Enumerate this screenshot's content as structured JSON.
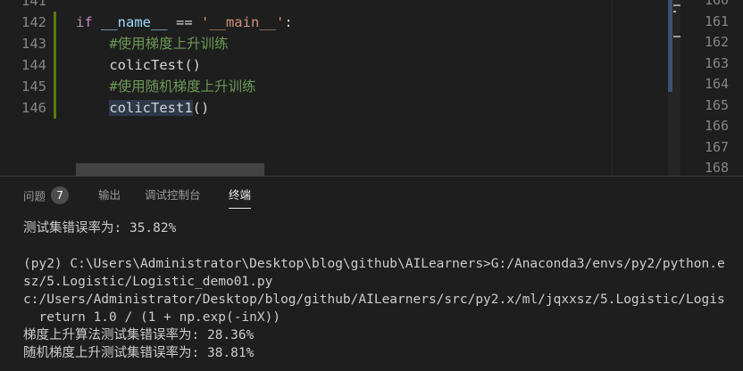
{
  "editor": {
    "lines": [
      {
        "n": "141",
        "tokens": []
      },
      {
        "n": "142",
        "tokens": [
          {
            "t": "if ",
            "c": "kw"
          },
          {
            "t": "__name__",
            "c": "dunder"
          },
          {
            "t": " == ",
            "c": "op"
          },
          {
            "t": "'__main__'",
            "c": "str"
          },
          {
            "t": ":",
            "c": "op"
          }
        ]
      },
      {
        "n": "143",
        "tokens": [
          {
            "t": "    #使用梯度上升训练",
            "c": "cmt"
          }
        ]
      },
      {
        "n": "144",
        "tokens": [
          {
            "t": "    ",
            "c": "op"
          },
          {
            "t": "colicTest()",
            "c": "op"
          }
        ]
      },
      {
        "n": "145",
        "tokens": [
          {
            "t": "    #使用随机梯度上升训练",
            "c": "cmt"
          }
        ]
      },
      {
        "n": "146",
        "tokens": [
          {
            "t": "    ",
            "c": "op"
          },
          {
            "t": "colicTest1",
            "c": "hl"
          },
          {
            "t": "()",
            "c": "op"
          }
        ]
      }
    ],
    "split_line_numbers": [
      "160",
      "161",
      "162",
      "163",
      "164",
      "165",
      "166",
      "167",
      "168"
    ]
  },
  "panel": {
    "tabs": [
      {
        "label": "问题",
        "badge": "7"
      },
      {
        "label": "输出"
      },
      {
        "label": "调试控制台"
      },
      {
        "label": "终端",
        "active": true
      }
    ],
    "terminal_lines": [
      "测试集错误率为: 35.82%",
      "",
      "(py2) C:\\Users\\Administrator\\Desktop\\blog\\github\\AILearners>G:/Anaconda3/envs/py2/python.e",
      "sz/5.Logistic/Logistic_demo01.py",
      "c:/Users/Administrator/Desktop/blog/github/AILearners/src/py2.x/ml/jqxxsz/5.Logistic/Logis",
      "  return 1.0 / (1 + np.exp(-inX))",
      "梯度上升算法测试集错误率为: 28.36%",
      "随机梯度上升测试集错误率为: 38.81%"
    ]
  },
  "colors": {
    "background": "#1e1e1e",
    "keyword": "#c586c0",
    "string": "#ce9178",
    "comment": "#6a9955",
    "modified_gutter": "#587c0c"
  }
}
